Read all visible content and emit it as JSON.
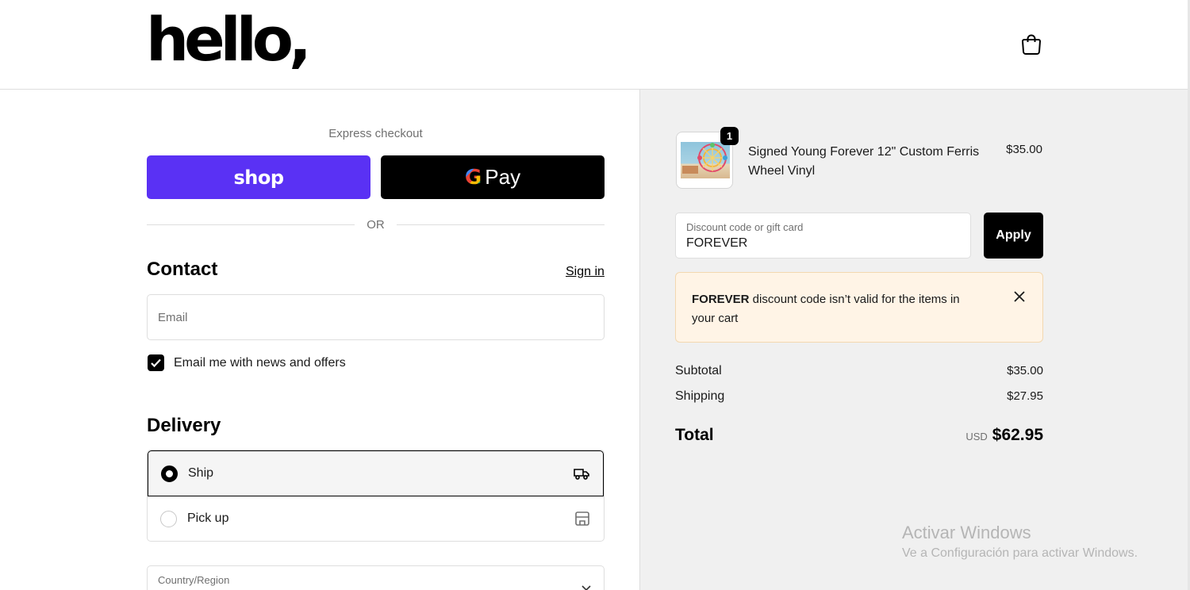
{
  "header": {
    "logo_text": "hello,",
    "cart_icon": "shopping-bag-icon"
  },
  "express": {
    "title": "Express checkout",
    "shop_label": "shop",
    "gpay_g": "G",
    "gpay_label": "Pay",
    "or_label": "OR"
  },
  "contact": {
    "title": "Contact",
    "sign_in": "Sign in",
    "email_placeholder": "Email",
    "newsletter_label": "Email me with news and offers",
    "newsletter_checked": true
  },
  "delivery": {
    "title": "Delivery",
    "options": [
      {
        "label": "Ship",
        "selected": true,
        "icon": "truck-icon"
      },
      {
        "label": "Pick up",
        "selected": false,
        "icon": "store-icon"
      }
    ],
    "country_label": "Country/Region"
  },
  "summary": {
    "item": {
      "quantity": "1",
      "name": "Signed Young Forever 12\" Custom Ferris Wheel Vinyl",
      "price": "$35.00"
    },
    "discount": {
      "label": "Discount code or gift card",
      "value": "FOREVER",
      "apply_label": "Apply"
    },
    "alert": {
      "code": "FOREVER",
      "message": " discount code isn’t valid for the items in your cart"
    },
    "subtotal_label": "Subtotal",
    "subtotal": "$35.00",
    "shipping_label": "Shipping",
    "shipping": "$27.95",
    "total_label": "Total",
    "currency": "USD",
    "total": "$62.95"
  },
  "watermark": {
    "line1": "Activar Windows",
    "line2": "Ve a Configuración para activar Windows."
  },
  "colors": {
    "shop_purple": "#5a31f4",
    "alert_bg": "#fff4e6",
    "summary_bg": "#f0f0f0"
  }
}
